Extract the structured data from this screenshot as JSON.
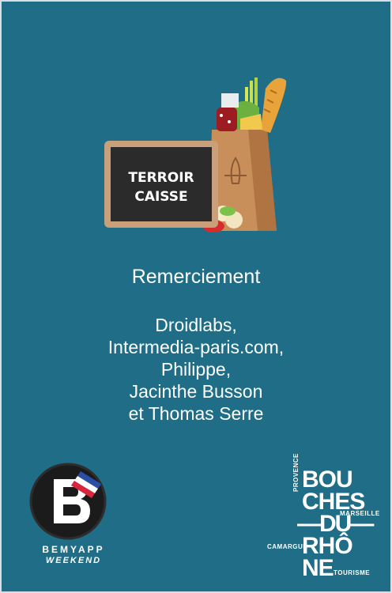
{
  "logo": {
    "chalkboard_line1": "TERROIR",
    "chalkboard_line2": "CAISSE"
  },
  "credits": {
    "title": "Remerciement",
    "names": [
      "Droidlabs,",
      "Intermedia-paris.com,",
      "Philippe,",
      "Jacinthe Busson",
      "et Thomas Serre"
    ]
  },
  "bemyapp": {
    "title": "BEMYAPP",
    "subtitle": "WEEKEND"
  },
  "bouches_du_rhone": {
    "line1": "BOU",
    "line2": "CHES",
    "line3": "—DU—",
    "line4": "RHÔ",
    "line5": "NE",
    "provence": "PROVENCE",
    "marseille": "MARSEILLE",
    "camargue": "CAMARGUE",
    "tourisme": "TOURISME"
  },
  "colors": {
    "background": "#1f6d86",
    "text": "#ffffff"
  }
}
